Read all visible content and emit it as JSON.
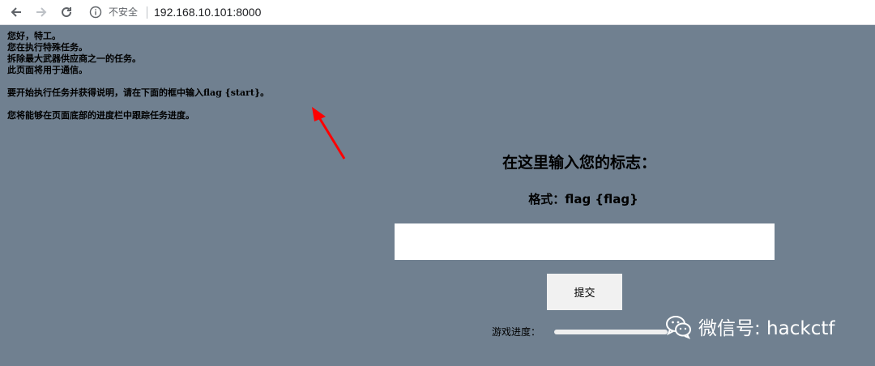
{
  "browser": {
    "security_label": "不安全",
    "url": "192.168.10.101:8000"
  },
  "intro": {
    "lines": [
      "您好，特工。",
      "您在执行特殊任务。",
      "拆除最大武器供应商之一的任务。",
      "此页面将用于通信。"
    ],
    "instruction": "要开始执行任务并获得说明，请在下面的框中输入flag {start}。",
    "progress_note": "您将能够在页面底部的进度栏中跟踪任务进度。"
  },
  "form": {
    "title": "在这里输入您的标志：",
    "format": "格式：flag {flag}",
    "input_value": "",
    "submit_label": "提交",
    "progress_label": "游戏进度：",
    "progress_value": 0
  },
  "watermark": {
    "text": "微信号: hackctf"
  },
  "colors": {
    "page_bg": "#708090",
    "arrow": "#ff0000"
  }
}
